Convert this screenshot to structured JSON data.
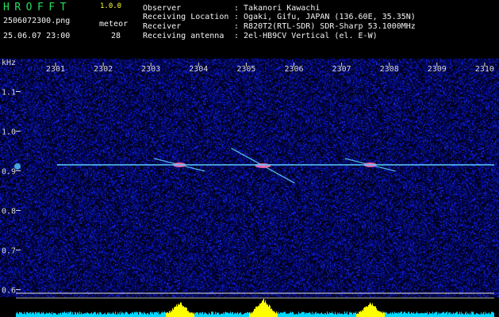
{
  "header": {
    "logo": "HROFFT",
    "version": "1.0.0",
    "filename": "2506072300.png",
    "datetime": "25.06.07 23:00",
    "meteor_label": "meteor",
    "meteor_count": "28"
  },
  "info": [
    {
      "label": "Observer",
      "value": ": Takanori Kawachi"
    },
    {
      "label": "Receiving Location",
      "value": ": Ogaki, Gifu, JAPAN (136.60E, 35.35N)"
    },
    {
      "label": "Receiver",
      "value": ": R820T2(RTL-SDR) SDR-Sharp 53.1000MHz"
    },
    {
      "label": "Receiving antenna",
      "value": ": 2el-HB9CV Vertical (el. E-W)"
    }
  ],
  "spectrogram": {
    "y_unit": "kHz",
    "time_labels": [
      "2301",
      "2302",
      "2303",
      "2304",
      "2305",
      "2306",
      "2307",
      "2308",
      "2309",
      "2310"
    ],
    "freq_labels": [
      "1.1",
      "1.0",
      "0.9",
      "0.8",
      "0.7",
      "0.6"
    ],
    "freq_values": [
      1.1,
      1.0,
      0.9,
      0.8,
      0.7,
      0.6
    ],
    "time_minutes": [
      1,
      2,
      3,
      4,
      5,
      6,
      7,
      8,
      9,
      10
    ],
    "freq_range_khz": [
      0.585,
      1.185
    ],
    "time_range_min": [
      0.6,
      10.4
    ],
    "carrier_khz": 0.915,
    "carrier_start_min": 1.03,
    "meteor_echoes": [
      {
        "center_min": 3.6,
        "center_khz": 0.915,
        "strength": 0.8
      },
      {
        "center_min": 5.35,
        "center_khz": 0.913,
        "strength": 1.0
      },
      {
        "center_min": 7.6,
        "center_khz": 0.915,
        "strength": 0.8
      }
    ],
    "colors": {
      "background": "#000000",
      "noise_blue": "#1a3cff",
      "carrier": "#58ccff",
      "echo_pink": "#ff6fb0",
      "level_cyan": "#00d8ff",
      "level_yellow": "#ffff00",
      "tick_label": "#d8d8d8"
    }
  }
}
